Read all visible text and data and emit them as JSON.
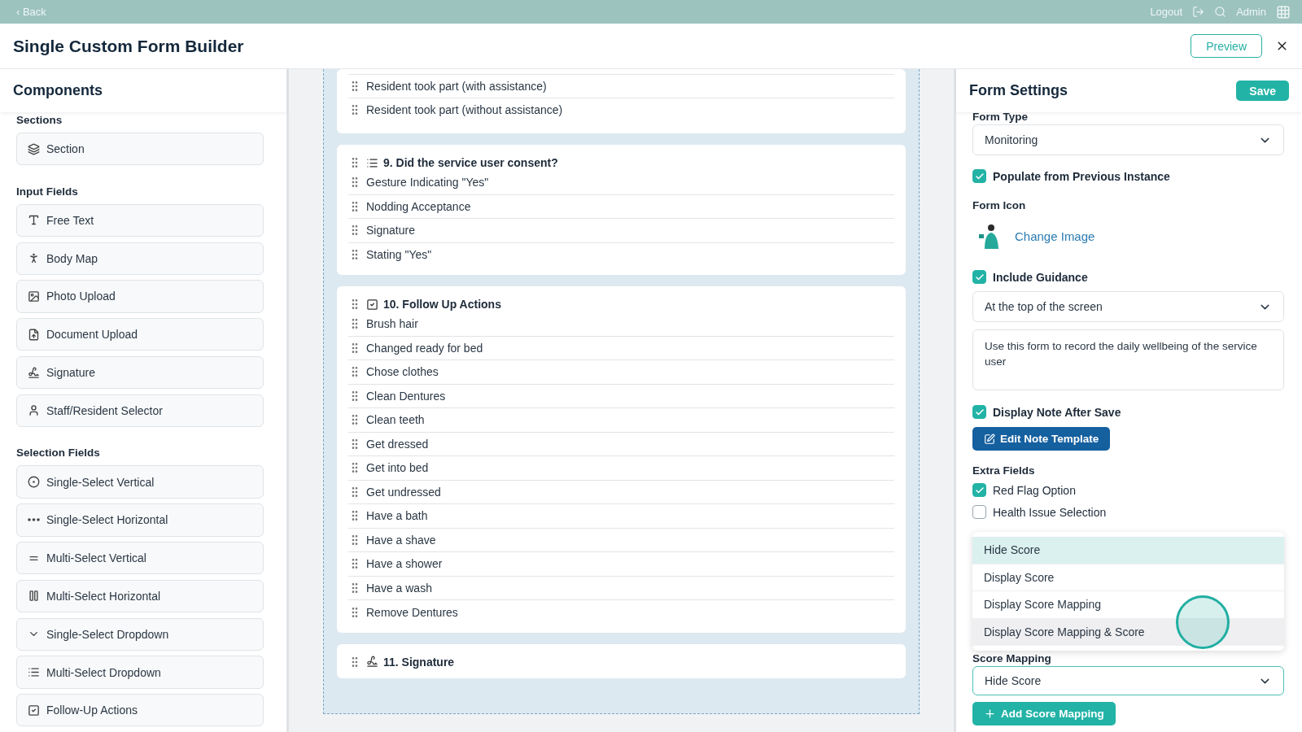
{
  "top_bar": {
    "back": "‹ Back",
    "logout": "Logout",
    "user": "Admin"
  },
  "header": {
    "title": "Single Custom Form Builder",
    "preview": "Preview"
  },
  "components": {
    "title": "Components",
    "groups": [
      {
        "label": "Sections",
        "items": [
          {
            "kind": "section",
            "label": "Section"
          }
        ]
      },
      {
        "label": "Input Fields",
        "items": [
          {
            "kind": "free-text",
            "label": "Free Text"
          },
          {
            "kind": "body-map",
            "label": "Body Map"
          },
          {
            "kind": "photo",
            "label": "Photo Upload"
          },
          {
            "kind": "document",
            "label": "Document Upload"
          },
          {
            "kind": "signature",
            "label": "Signature"
          },
          {
            "kind": "person",
            "label": "Staff/Resident Selector"
          }
        ]
      },
      {
        "label": "Selection Fields",
        "items": [
          {
            "kind": "radio",
            "label": "Single-Select Vertical"
          },
          {
            "kind": "dots",
            "label": "Single-Select Horizontal"
          },
          {
            "kind": "rows",
            "label": "Multi-Select Vertical"
          },
          {
            "kind": "columns",
            "label": "Multi-Select Horizontal"
          },
          {
            "kind": "chevron",
            "label": "Single-Select Dropdown"
          },
          {
            "kind": "list",
            "label": "Multi-Select Dropdown"
          },
          {
            "kind": "checkbox",
            "label": "Follow-Up Actions"
          }
        ]
      }
    ]
  },
  "canvas": {
    "cards": [
      {
        "kind": "continued",
        "options": [
          "Resident took part (with assistance)",
          "Resident took part (without assistance)"
        ]
      },
      {
        "kind": "list",
        "title": "9. Did the service user consent?",
        "options": [
          "Gesture Indicating \"Yes\"",
          "Nodding Acceptance",
          "Signature",
          "Stating \"Yes\""
        ]
      },
      {
        "kind": "checkbox",
        "title": "10. Follow Up Actions",
        "options": [
          "Brush hair",
          "Changed ready for bed",
          "Chose clothes",
          "Clean Dentures",
          "Clean teeth",
          "Get dressed",
          "Get into bed",
          "Get undressed",
          "Have a bath",
          "Have a shave",
          "Have a shower",
          "Have a wash",
          "Remove Dentures"
        ]
      },
      {
        "kind": "signature",
        "title": "11. Signature"
      }
    ]
  },
  "settings": {
    "title": "Form Settings",
    "save": "Save",
    "form_type": {
      "label": "Form Type",
      "value": "Monitoring"
    },
    "populate": {
      "label": "Populate from Previous Instance",
      "checked": true
    },
    "form_icon": {
      "label": "Form Icon",
      "link": "Change Image"
    },
    "guidance": {
      "label": "Include Guidance",
      "checked": true
    },
    "guidance_position": {
      "value": "At the top of the screen"
    },
    "guidance_text": {
      "value": "Use this form to record the daily wellbeing of the service user"
    },
    "display_note": {
      "label": "Display Note After Save",
      "checked": true
    },
    "edit_note": "Edit Note Template",
    "extra_fields": {
      "label": "Extra Fields",
      "options": [
        {
          "label": "Red Flag Option",
          "checked": true
        },
        {
          "label": "Health Issue Selection",
          "checked": false
        }
      ]
    },
    "score_menu": {
      "options": [
        {
          "label": "Hide Score",
          "selected": true,
          "hovered": false
        },
        {
          "label": "Display Score",
          "selected": false,
          "hovered": false
        },
        {
          "label": "Display Score Mapping",
          "selected": false,
          "hovered": false
        },
        {
          "label": "Display Score Mapping & Score",
          "selected": false,
          "hovered": true
        }
      ]
    },
    "score_mapping": {
      "label": "Score Mapping",
      "value": "Hide Score"
    },
    "add_mapping": "Add Score Mapping"
  }
}
